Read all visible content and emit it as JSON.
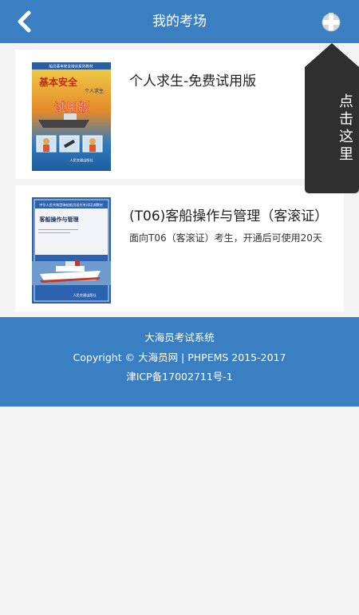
{
  "header": {
    "title": "我的考场",
    "back_icon": "chevron-left-icon",
    "add_icon": "plus-circle-icon"
  },
  "items": [
    {
      "title": "个人求生-免费试用版",
      "description": "",
      "cover": {
        "top_text": "船员基本安全培训系列教材",
        "title_main": "基本安全",
        "title_sub": "个人求生",
        "badge": "试用版",
        "publisher": "人民交通出版社"
      }
    },
    {
      "title": "(T06)客船操作与管理（客滚证）",
      "description": "面向T06（客滚证）考生，开通后可使用20天",
      "cover": {
        "top_text": "中华人民共和国海船船员适任考试培训教材",
        "title_main": "客船操作与管理",
        "publisher": "人民交通出版社"
      }
    }
  ],
  "footer": {
    "line1": "大海员考试系统",
    "line2": "Copyright © 大海员网 | PHPEMS 2015-2017",
    "line3": "津ICP备17002711号-1"
  },
  "tooltip": {
    "text": "点击这里"
  },
  "colors": {
    "brand_blue": "#3a7fc1",
    "tooltip_bg": "#2f2f2f",
    "page_bg": "#f3f3f3"
  }
}
